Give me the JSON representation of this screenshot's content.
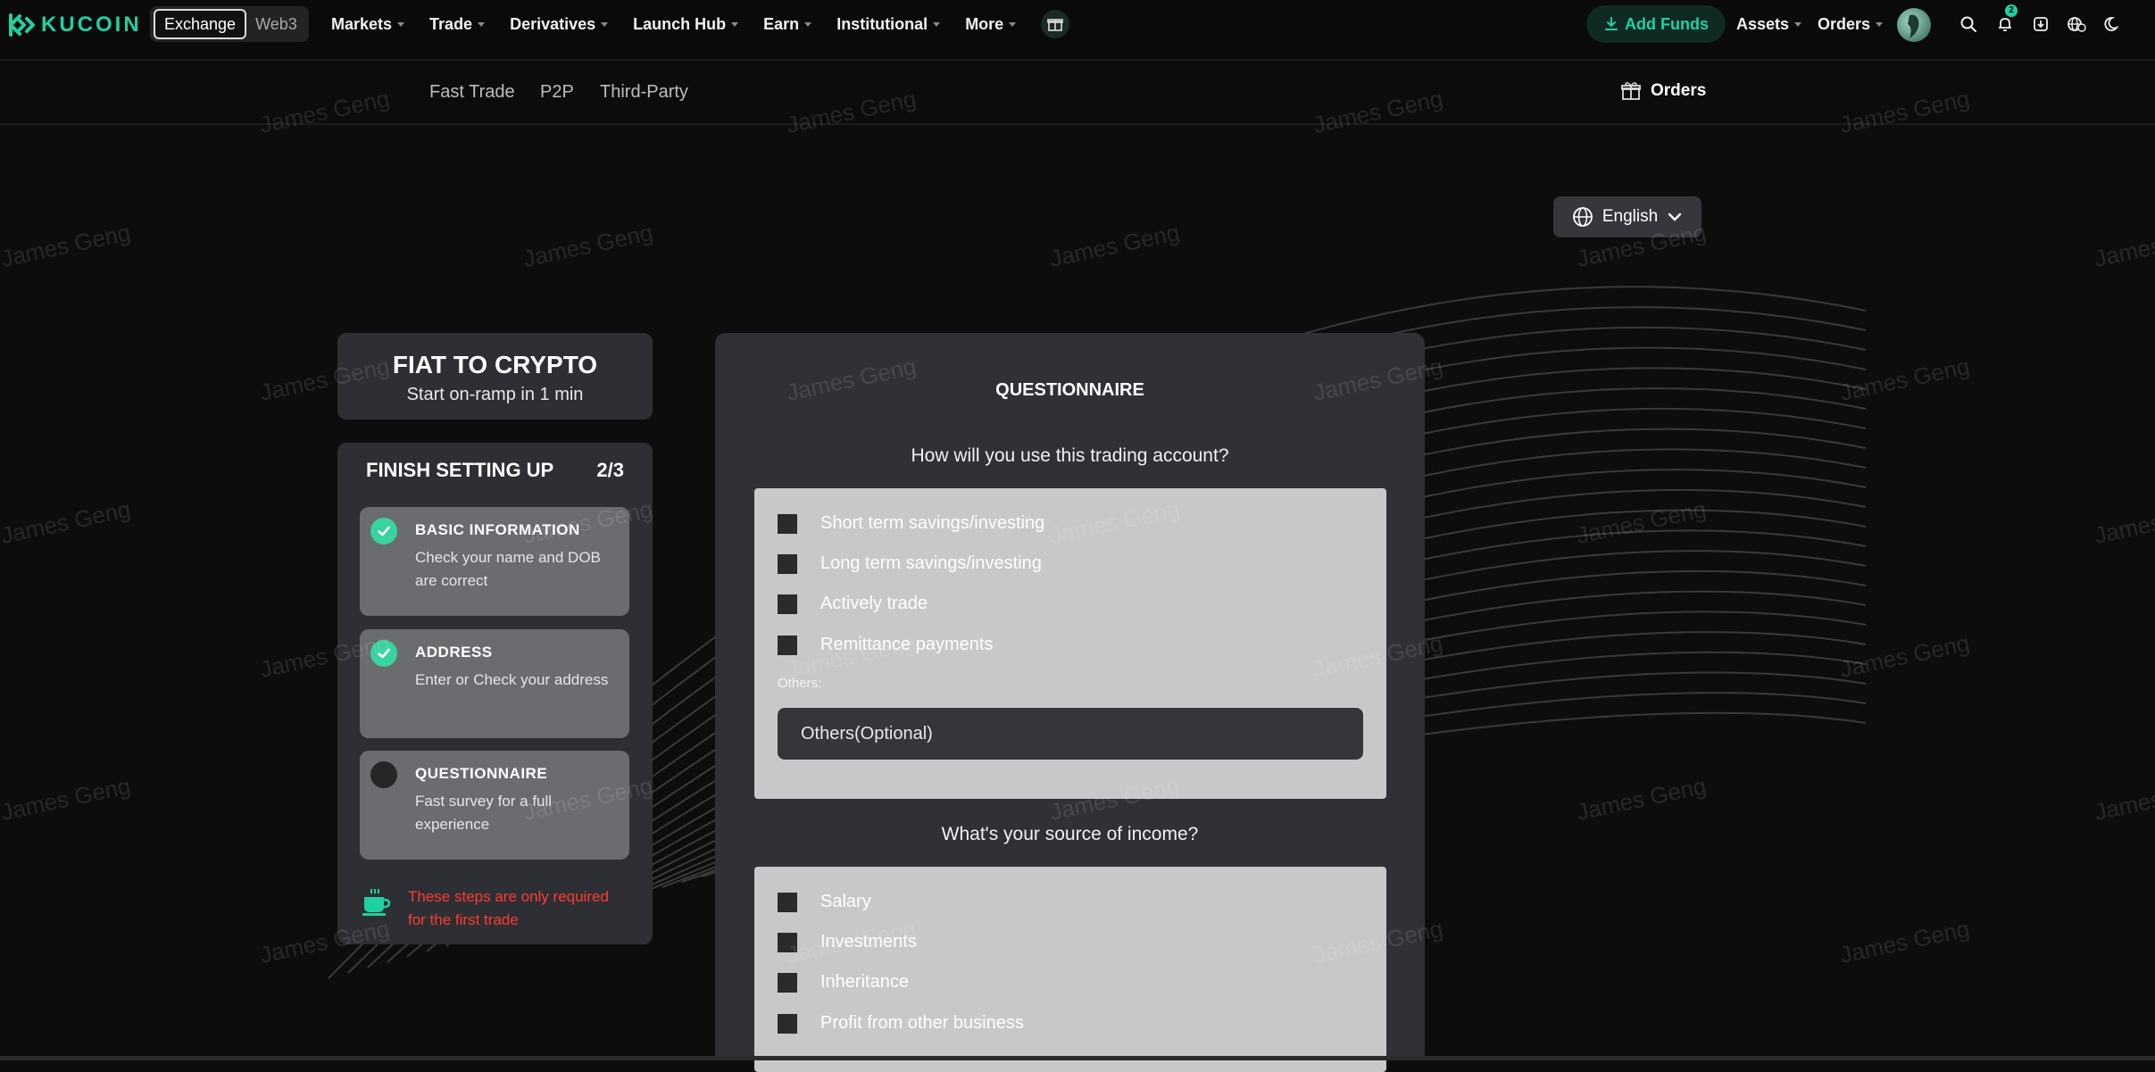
{
  "app": {
    "logo_text": "KUCOIN",
    "accent": "#1fd1a1"
  },
  "header": {
    "modes": {
      "exchange": "Exchange",
      "web3": "Web3"
    },
    "nav": [
      {
        "label": "Markets"
      },
      {
        "label": "Trade"
      },
      {
        "label": "Derivatives"
      },
      {
        "label": "Launch Hub"
      },
      {
        "label": "Earn"
      },
      {
        "label": "Institutional"
      },
      {
        "label": "More"
      }
    ],
    "add_funds": "Add Funds",
    "assets": "Assets",
    "orders": "Orders",
    "notification_count": "2",
    "icons": [
      "gift-icon",
      "search-icon",
      "bell-icon",
      "download-icon",
      "globe-currency-icon",
      "moon-icon"
    ]
  },
  "subnav": {
    "items": [
      {
        "label": "Fast Trade"
      },
      {
        "label": "P2P"
      },
      {
        "label": "Third-Party"
      }
    ],
    "orders": "Orders"
  },
  "language": {
    "selected": "English"
  },
  "fiat": {
    "title": "FIAT TO CRYPTO",
    "subtitle": "Start on-ramp in 1 min"
  },
  "setup": {
    "title": "FINISH SETTING UP",
    "progress": "2/3",
    "steps": [
      {
        "title": "BASIC INFORMATION",
        "desc": "Check your name and DOB are correct",
        "done": true
      },
      {
        "title": "ADDRESS",
        "desc": "Enter or Check your address",
        "done": true
      },
      {
        "title": "QUESTIONNAIRE",
        "desc": "Fast survey for a full experience",
        "done": false
      }
    ],
    "note": "These steps are only required for the first trade",
    "note_color": "#ff3b30"
  },
  "questionnaire": {
    "title": "QUESTIONNAIRE",
    "q1": {
      "question": "How will you use this trading account?",
      "options": [
        {
          "label": "Short term savings/investing"
        },
        {
          "label": "Long term savings/investing"
        },
        {
          "label": "Actively trade"
        },
        {
          "label": "Remittance payments"
        }
      ],
      "others_label": "Others:",
      "others_placeholder": "Others(Optional)"
    },
    "q2": {
      "question": "What's your source of income?",
      "options": [
        {
          "label": "Salary"
        },
        {
          "label": "Investments"
        },
        {
          "label": "Inheritance"
        },
        {
          "label": "Profit from other business"
        }
      ]
    }
  },
  "watermark": "James Geng"
}
